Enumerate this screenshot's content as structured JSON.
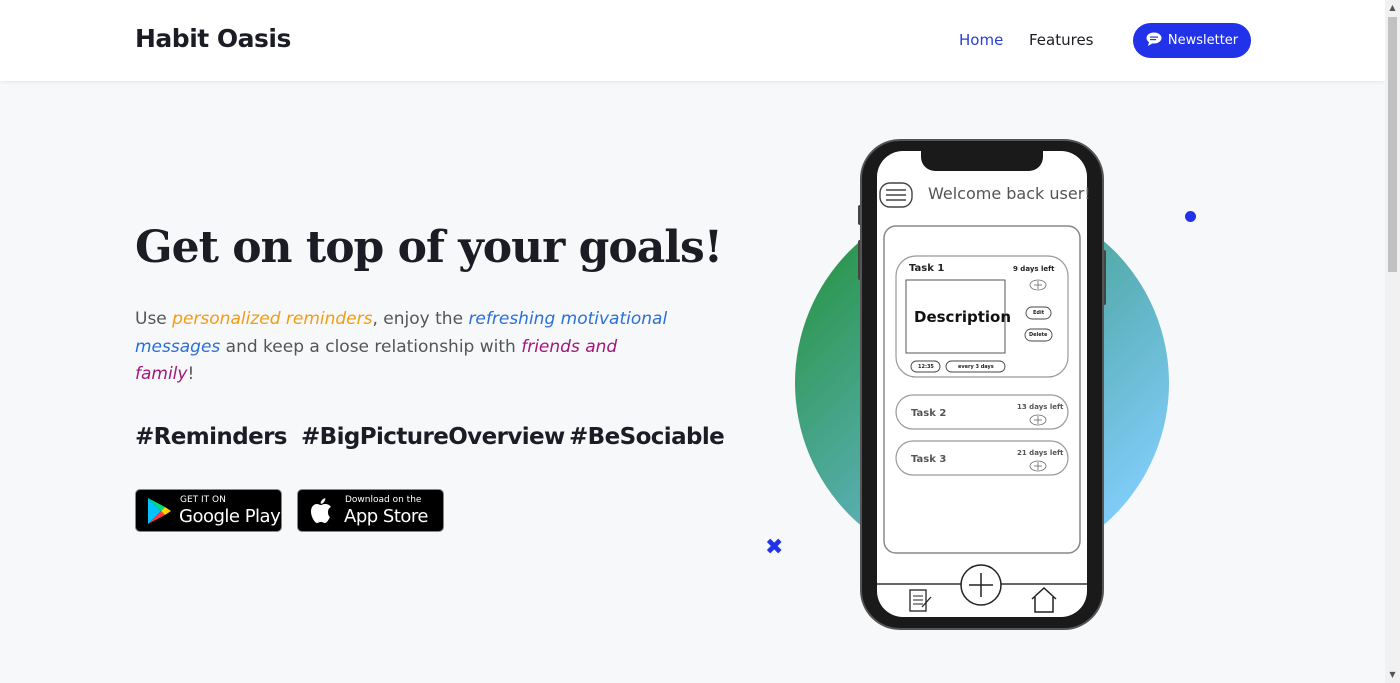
{
  "header": {
    "brand": "Habit Oasis",
    "nav": {
      "home": "Home",
      "features": "Features"
    },
    "newsletter_label": "Newsletter"
  },
  "hero": {
    "title": "Get on top of your goals!",
    "text": {
      "p1": "Use ",
      "hl1": "personalized reminders",
      "p2": ", enjoy the ",
      "hl2": "refreshing motivational messages",
      "p3": " and keep a close relationship with ",
      "hl3": "friends and family",
      "p4": "!"
    },
    "hashtags": [
      "#Reminders",
      "#BigPictureOverview",
      "#BeSociable"
    ]
  },
  "badges": {
    "google": {
      "small": "GET IT ON",
      "big": "Google Play"
    },
    "apple": {
      "small": "Download on the",
      "big": "App Store"
    }
  },
  "mockup": {
    "welcome": "Welcome back user!",
    "task1": {
      "title": "Task 1",
      "due": "9 days left",
      "description": "Description",
      "edit": "Edit",
      "delete": "Delete",
      "time": "12:35",
      "repeat": "every 3 days"
    },
    "task2": {
      "title": "Task 2",
      "due": "13 days left"
    },
    "task3": {
      "title": "Task 3",
      "due": "21 days left"
    }
  },
  "colors": {
    "accent": "#2232e8",
    "orange": "#f39c12",
    "blue": "#2a6fd8",
    "purple": "#a4167a"
  }
}
